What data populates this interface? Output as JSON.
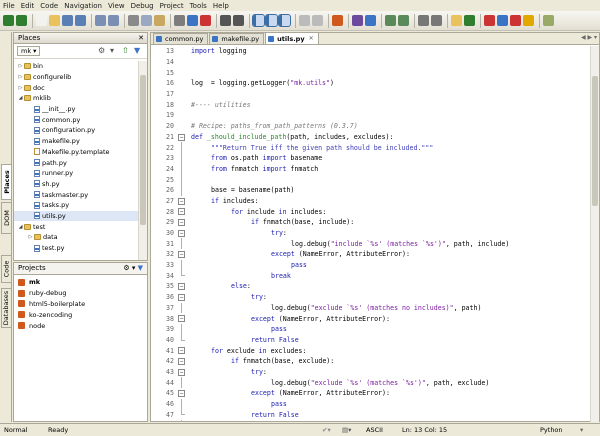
{
  "menu": [
    "File",
    "Edit",
    "Code",
    "Navigation",
    "View",
    "Debug",
    "Project",
    "Tools",
    "Help"
  ],
  "places": {
    "title": "Places",
    "crumb": "mk",
    "tree": [
      {
        "label": "bin",
        "type": "folder",
        "depth": 0,
        "twisty": "▷"
      },
      {
        "label": "configurelib",
        "type": "folder",
        "depth": 0,
        "twisty": "▷"
      },
      {
        "label": "doc",
        "type": "folder",
        "depth": 0,
        "twisty": "▷"
      },
      {
        "label": "mklib",
        "type": "folder",
        "depth": 0,
        "twisty": "◢"
      },
      {
        "label": "__init__.py",
        "type": "py",
        "depth": 1,
        "twisty": ""
      },
      {
        "label": "common.py",
        "type": "py",
        "depth": 1,
        "twisty": ""
      },
      {
        "label": "configuration.py",
        "type": "py",
        "depth": 1,
        "twisty": ""
      },
      {
        "label": "makefile.py",
        "type": "py",
        "depth": 1,
        "twisty": ""
      },
      {
        "label": "Makefile.py.template",
        "type": "tpl",
        "depth": 1,
        "twisty": ""
      },
      {
        "label": "path.py",
        "type": "py",
        "depth": 1,
        "twisty": ""
      },
      {
        "label": "runner.py",
        "type": "py",
        "depth": 1,
        "twisty": ""
      },
      {
        "label": "sh.py",
        "type": "py",
        "depth": 1,
        "twisty": ""
      },
      {
        "label": "taskmaster.py",
        "type": "py",
        "depth": 1,
        "twisty": ""
      },
      {
        "label": "tasks.py",
        "type": "py",
        "depth": 1,
        "twisty": ""
      },
      {
        "label": "utils.py",
        "type": "py",
        "depth": 1,
        "twisty": "",
        "selected": true
      },
      {
        "label": "test",
        "type": "folder",
        "depth": 0,
        "twisty": "◢"
      },
      {
        "label": "data",
        "type": "folder",
        "depth": 1,
        "twisty": "▷"
      },
      {
        "label": "test.py",
        "type": "py",
        "depth": 1,
        "twisty": ""
      }
    ]
  },
  "vtabs": [
    "Places",
    "DOM",
    "Code",
    "Databases"
  ],
  "projects": {
    "title": "Projects",
    "items": [
      {
        "label": "mk",
        "bold": true,
        "color": "#d05a1e"
      },
      {
        "label": "ruby-debug",
        "bold": false,
        "color": "#d05a1e"
      },
      {
        "label": "html5-boilerplate",
        "bold": false,
        "color": "#d05a1e"
      },
      {
        "label": "ko-zencoding",
        "bold": false,
        "color": "#d05a1e"
      },
      {
        "label": "node",
        "bold": false,
        "color": "#d05a1e"
      }
    ]
  },
  "tabs": [
    {
      "label": "common.py",
      "active": false
    },
    {
      "label": "makefile.py",
      "active": false
    },
    {
      "label": "utils.py",
      "active": true
    }
  ],
  "code": [
    {
      "n": "13",
      "indent": 0,
      "fold": "",
      "parts": [
        [
          "kw",
          "import"
        ],
        [
          "t",
          " logging"
        ]
      ]
    },
    {
      "n": "14",
      "indent": 0,
      "fold": "",
      "parts": []
    },
    {
      "n": "15",
      "indent": 0,
      "fold": "",
      "parts": []
    },
    {
      "n": "16",
      "indent": 0,
      "fold": "",
      "parts": [
        [
          "t",
          "log  = logging.getLogger("
        ],
        [
          "str",
          "\"mk.utils\""
        ],
        [
          "t",
          ")"
        ]
      ]
    },
    {
      "n": "17",
      "indent": 0,
      "fold": "",
      "parts": []
    },
    {
      "n": "18",
      "indent": 0,
      "fold": "",
      "parts": [
        [
          "com",
          "#---- utilities"
        ]
      ]
    },
    {
      "n": "19",
      "indent": 0,
      "fold": "",
      "parts": []
    },
    {
      "n": "20",
      "indent": 0,
      "fold": "",
      "parts": [
        [
          "com",
          "# Recipe: paths_from_path_patterns (0.3.7)"
        ]
      ]
    },
    {
      "n": "21",
      "indent": 0,
      "fold": "open",
      "parts": [
        [
          "kw",
          "def"
        ],
        [
          "t",
          " "
        ],
        [
          "fn",
          "_should_include_path"
        ],
        [
          "t",
          "(path, includes, excludes):"
        ]
      ]
    },
    {
      "n": "22",
      "indent": 1,
      "fold": "line",
      "parts": [
        [
          "doc",
          "\"\"\"Return True iff the given path should be included.\"\"\""
        ]
      ]
    },
    {
      "n": "23",
      "indent": 1,
      "fold": "line",
      "parts": [
        [
          "kw",
          "from"
        ],
        [
          "t",
          " os.path "
        ],
        [
          "kw",
          "import"
        ],
        [
          "t",
          " basename"
        ]
      ]
    },
    {
      "n": "24",
      "indent": 1,
      "fold": "line",
      "parts": [
        [
          "kw",
          "from"
        ],
        [
          "t",
          " fnmatch "
        ],
        [
          "kw",
          "import"
        ],
        [
          "t",
          " fnmatch"
        ]
      ]
    },
    {
      "n": "25",
      "indent": 0,
      "fold": "line",
      "parts": []
    },
    {
      "n": "26",
      "indent": 1,
      "fold": "line",
      "parts": [
        [
          "t",
          "base = basename(path)"
        ]
      ]
    },
    {
      "n": "27",
      "indent": 1,
      "fold": "open",
      "parts": [
        [
          "kw",
          "if"
        ],
        [
          "t",
          " includes:"
        ]
      ]
    },
    {
      "n": "28",
      "indent": 2,
      "fold": "open",
      "parts": [
        [
          "kw",
          "for"
        ],
        [
          "t",
          " include "
        ],
        [
          "kw",
          "in"
        ],
        [
          "t",
          " includes:"
        ]
      ]
    },
    {
      "n": "29",
      "indent": 3,
      "fold": "open",
      "parts": [
        [
          "kw",
          "if"
        ],
        [
          "t",
          " fnmatch(base, include):"
        ]
      ]
    },
    {
      "n": "30",
      "indent": 4,
      "fold": "open",
      "parts": [
        [
          "kw",
          "try"
        ],
        [
          "t",
          ":"
        ]
      ]
    },
    {
      "n": "31",
      "indent": 5,
      "fold": "line",
      "parts": [
        [
          "t",
          "log.debug("
        ],
        [
          "str",
          "\"include `%s' (matches `%s')\""
        ],
        [
          "t",
          ", path, include)"
        ]
      ]
    },
    {
      "n": "32",
      "indent": 4,
      "fold": "open",
      "parts": [
        [
          "kw",
          "except"
        ],
        [
          "t",
          " (NameError, AttributeError):"
        ]
      ]
    },
    {
      "n": "33",
      "indent": 5,
      "fold": "line",
      "parts": [
        [
          "kw",
          "pass"
        ]
      ]
    },
    {
      "n": "34",
      "indent": 4,
      "fold": "end",
      "parts": [
        [
          "kw",
          "break"
        ]
      ]
    },
    {
      "n": "35",
      "indent": 2,
      "fold": "open",
      "parts": [
        [
          "kw",
          "else"
        ],
        [
          "t",
          ":"
        ]
      ]
    },
    {
      "n": "36",
      "indent": 3,
      "fold": "open",
      "parts": [
        [
          "kw",
          "try"
        ],
        [
          "t",
          ":"
        ]
      ]
    },
    {
      "n": "37",
      "indent": 4,
      "fold": "line",
      "parts": [
        [
          "t",
          "log.debug("
        ],
        [
          "str",
          "\"exclude `%s' (matches no includes)\""
        ],
        [
          "t",
          ", path)"
        ]
      ]
    },
    {
      "n": "38",
      "indent": 3,
      "fold": "open",
      "parts": [
        [
          "kw",
          "except"
        ],
        [
          "t",
          " (NameError, AttributeError):"
        ]
      ]
    },
    {
      "n": "39",
      "indent": 4,
      "fold": "line",
      "parts": [
        [
          "kw",
          "pass"
        ]
      ]
    },
    {
      "n": "40",
      "indent": 3,
      "fold": "end",
      "parts": [
        [
          "kw",
          "return"
        ],
        [
          "t",
          " "
        ],
        [
          "kw",
          "False"
        ]
      ]
    },
    {
      "n": "41",
      "indent": 1,
      "fold": "open",
      "parts": [
        [
          "kw",
          "for"
        ],
        [
          "t",
          " exclude "
        ],
        [
          "kw",
          "in"
        ],
        [
          "t",
          " excludes:"
        ]
      ]
    },
    {
      "n": "42",
      "indent": 2,
      "fold": "open",
      "parts": [
        [
          "kw",
          "if"
        ],
        [
          "t",
          " fnmatch(base, exclude):"
        ]
      ]
    },
    {
      "n": "43",
      "indent": 3,
      "fold": "open",
      "parts": [
        [
          "kw",
          "try"
        ],
        [
          "t",
          ":"
        ]
      ]
    },
    {
      "n": "44",
      "indent": 4,
      "fold": "line",
      "parts": [
        [
          "t",
          "log.debug("
        ],
        [
          "str",
          "\"exclude `%s' (matches `%s')\""
        ],
        [
          "t",
          ", path, exclude)"
        ]
      ]
    },
    {
      "n": "45",
      "indent": 3,
      "fold": "open",
      "parts": [
        [
          "kw",
          "except"
        ],
        [
          "t",
          " (NameError, AttributeError):"
        ]
      ]
    },
    {
      "n": "46",
      "indent": 4,
      "fold": "line",
      "parts": [
        [
          "kw",
          "pass"
        ]
      ]
    },
    {
      "n": "47",
      "indent": 3,
      "fold": "end",
      "parts": [
        [
          "kw",
          "return"
        ],
        [
          "t",
          " "
        ],
        [
          "kw",
          "False"
        ]
      ]
    },
    {
      "n": "48",
      "indent": 1,
      "fold": "end",
      "parts": [
        [
          "kw",
          "return"
        ],
        [
          "t",
          " "
        ],
        [
          "kw",
          "True"
        ]
      ]
    }
  ],
  "colors": {
    "keyword": "#1b1bb0",
    "string": "#7a1fa2",
    "comment": "#7a7a7a",
    "docstring": "#3d3db8",
    "funcname": "#2a8a2a"
  },
  "status": {
    "mode": "Normal",
    "state": "Ready",
    "encoding": "ASCII",
    "position": "Ln: 13 Col: 15",
    "language": "Python"
  }
}
